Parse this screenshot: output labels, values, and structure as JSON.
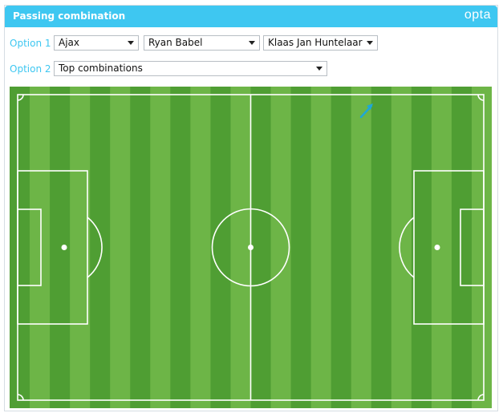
{
  "header": {
    "title": "Passing combination",
    "brand": "opta"
  },
  "option1": {
    "label": "Option 1",
    "team": "Ajax",
    "player_from": "Ryan Babel",
    "player_to": "Klaas Jan Huntelaar"
  },
  "option2": {
    "label": "Option 2",
    "mode": "Top combinations"
  },
  "colors": {
    "header": "#3ec7f1",
    "label": "#3ec7f1",
    "pitch_dark": "#4f9e33",
    "pitch_light": "#6db547",
    "lines": "#ffffff",
    "pass_arrow": "#1ea7d6"
  },
  "icons": {
    "dropdown": "chevron-down-icon",
    "pass": "pass-arrow-icon"
  }
}
